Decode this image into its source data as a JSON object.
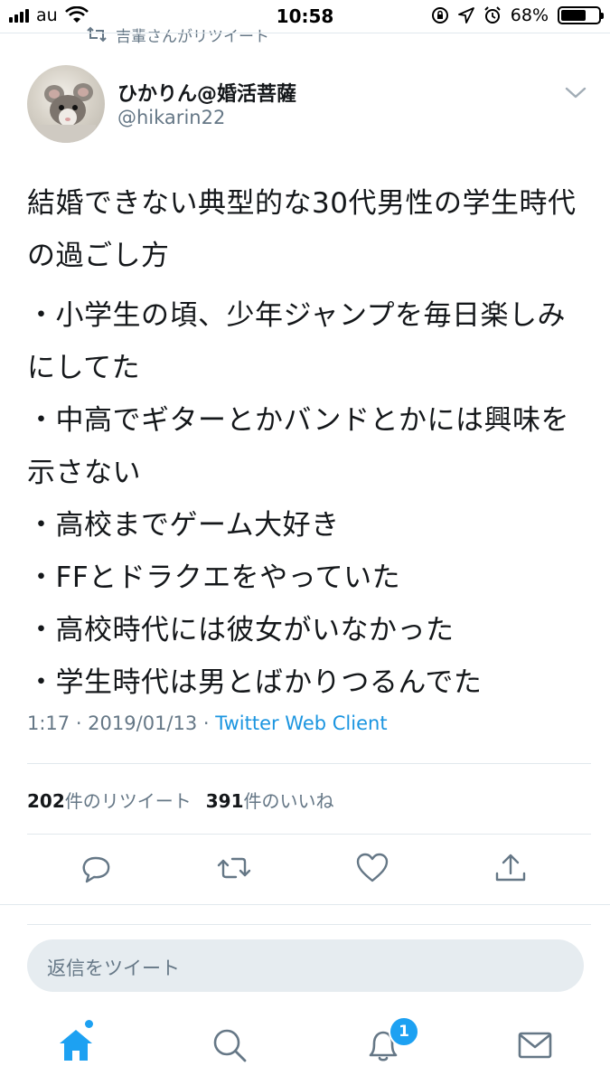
{
  "status_bar": {
    "carrier": "au",
    "time": "10:58",
    "battery": "68%",
    "battery_level": 0.68,
    "icons": [
      "signal-bars-icon",
      "wifi-icon",
      "rotation-lock-icon",
      "location-icon",
      "alarm-icon",
      "battery-icon"
    ]
  },
  "tweet": {
    "retweet_context": "吉輩さんがリツイート",
    "author": {
      "display_name": "ひかりん@婚活菩薩",
      "handle": "@hikarin22"
    },
    "text_intro": "結婚できない典型的な30代男性の学生時代の過ごし方",
    "text_lines": [
      "・小学生の頃、少年ジャンプを毎日楽しみにしてた",
      "・中高でギターとかバンドとかには興味を示さない",
      "・高校までゲーム大好き",
      "・FFとドラクエをやっていた",
      "・高校時代には彼女がいなかった",
      "・学生時代は男とばかりつるんでた"
    ],
    "timestamp": "1:17 · 2019/01/13 · ",
    "source": "Twitter Web Client",
    "retweets_count": "202",
    "retweets_label": "件のリツイート",
    "likes_count": "391",
    "likes_label": "件のいいね"
  },
  "actions": [
    "reply-icon",
    "retweet-icon",
    "like-icon",
    "share-icon"
  ],
  "reply_box": {
    "placeholder": "返信をツイート"
  },
  "tabbar": {
    "tabs": [
      "home-icon",
      "search-icon",
      "notifications-icon",
      "messages-icon"
    ],
    "notifications_badge": "1"
  },
  "colors": {
    "accent": "#1da1f2",
    "link": "#1b95e0",
    "secondary_text": "#657786",
    "divider": "#e1e8ed"
  }
}
